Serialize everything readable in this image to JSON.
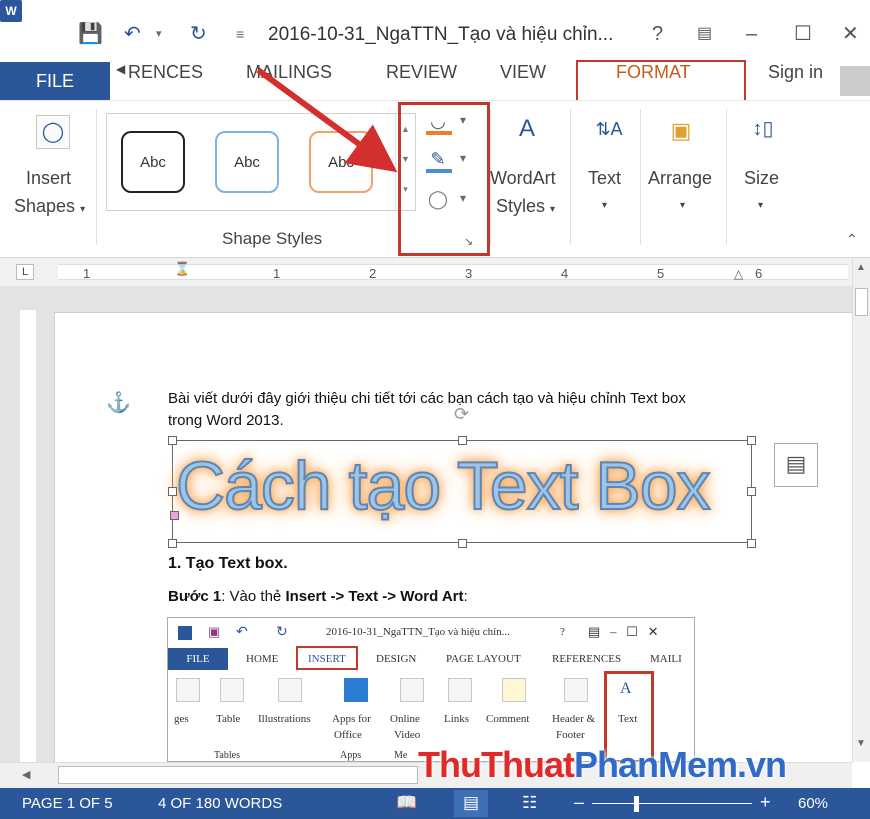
{
  "titlebar": {
    "word_icon": "W",
    "save_icon": "save-icon",
    "undo_icon": "undo-icon",
    "redo_icon": "redo-icon",
    "doc_title": "2016-10-31_NgaTTN_Tạo và hiệu chỉn...",
    "help": "?",
    "minimize": "–",
    "maximize": "☐",
    "close": "✕"
  },
  "tabs": {
    "file": "FILE",
    "references": "RENCES",
    "mailings": "MAILINGS",
    "review": "REVIEW",
    "view": "VIEW",
    "format": "FORMAT",
    "sign_in": "Sign in"
  },
  "ribbon": {
    "insert_shapes_1": "Insert",
    "insert_shapes_2": "Shapes",
    "style_1": "Abc",
    "style_2": "Abc",
    "style_3": "Abc",
    "group_label": "Shape Styles",
    "wordart_1": "WordArt",
    "wordart_2": "Styles",
    "text": "Text",
    "arrange": "Arrange",
    "size": "Size"
  },
  "ruler": {
    "numbers": [
      "1",
      "1",
      "2",
      "3",
      "4",
      "5",
      "6"
    ]
  },
  "document": {
    "intro_line1": "Bài viết dưới đây giới thiệu chi tiết tới các bạn cách tạo và hiệu chỉnh Text box",
    "intro_line2": "trong Word 2013.",
    "wordart_text": "Cách tạo Text Box",
    "heading": "1. Tạo Text box.",
    "step_label": "Bước 1",
    "step_text": ": Vào thẻ ",
    "step_bold": "Insert -> Text -> Word Art",
    "step_end": ":"
  },
  "mini": {
    "doc_title": "2016-10-31_NgaTTN_Tạo và hiệu chỉn...",
    "help": "?",
    "tabs": [
      "FILE",
      "HOME",
      "INSERT",
      "DESIGN",
      "PAGE LAYOUT",
      "REFERENCES",
      "MAILI"
    ],
    "groups": [
      {
        "label": "ges"
      },
      {
        "label": "Table",
        "sub": "Tables"
      },
      {
        "label": "Illustrations"
      },
      {
        "label": "Apps for",
        "label2": "Office",
        "sub": "Apps"
      },
      {
        "label": "Online",
        "label2": "Video",
        "sub": "Me"
      },
      {
        "label": "Links"
      },
      {
        "label": "Comment"
      },
      {
        "label": "Header &",
        "label2": "Footer"
      },
      {
        "label": "Text"
      }
    ]
  },
  "status": {
    "page": "PAGE 1 OF 5",
    "words": "4 OF 180 WORDS",
    "minus": "–",
    "plus": "+",
    "zoom": "60%"
  },
  "watermark": {
    "part1": "ThuThuat",
    "part2": "PhanMem.vn"
  },
  "colors": {
    "accent": "#2b579a",
    "format_tab": "#c65a1f",
    "highlight": "#c0392b"
  }
}
